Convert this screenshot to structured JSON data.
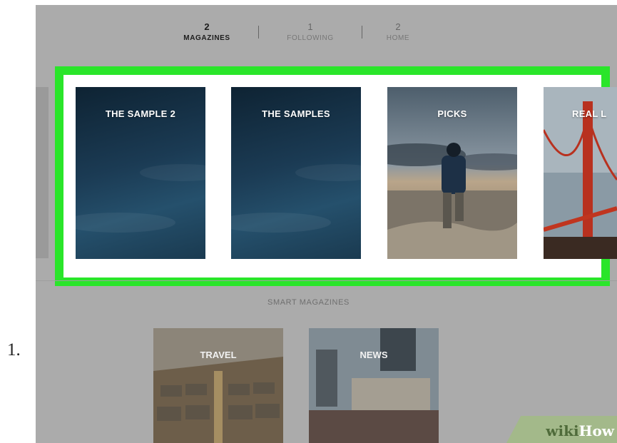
{
  "step_number": "1.",
  "stats": [
    {
      "count": "2",
      "label": "MAGAZINES",
      "active": true
    },
    {
      "count": "1",
      "label": "FOLLOWING",
      "active": false
    },
    {
      "count": "2",
      "label": "HOME",
      "active": false
    }
  ],
  "magazines": [
    {
      "title": "THE SAMPLE 2"
    },
    {
      "title": "THE SAMPLES"
    },
    {
      "title": "PICKS"
    },
    {
      "title": "REAL L"
    }
  ],
  "smart_section": {
    "label": "SMART MAGAZINES",
    "items": [
      {
        "title": "TRAVEL"
      },
      {
        "title": "NEWS"
      }
    ]
  },
  "watermark": {
    "wiki": "wiki",
    "how": "How"
  },
  "colors": {
    "highlight_border": "#2ae52a",
    "overlay_gray": "#ababab",
    "card_dark": "#1b3b54"
  }
}
